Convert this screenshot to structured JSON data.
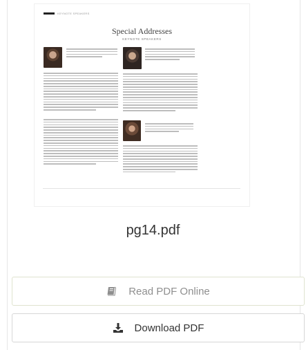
{
  "file": {
    "name": "pg14.pdf"
  },
  "thumbnail": {
    "header_text": "KEYNOTE SPEAKERS",
    "title": "Special Addresses",
    "subtitle": "KEYNOTE SPEAKERS"
  },
  "actions": {
    "read_label": "Read PDF Online",
    "download_label": "Download PDF"
  },
  "icons": {
    "read": "book-icon",
    "download": "download-icon"
  },
  "colors": {
    "read_border": "#dfe3cf",
    "read_text": "#8f8f8f",
    "download_text": "#333333"
  }
}
